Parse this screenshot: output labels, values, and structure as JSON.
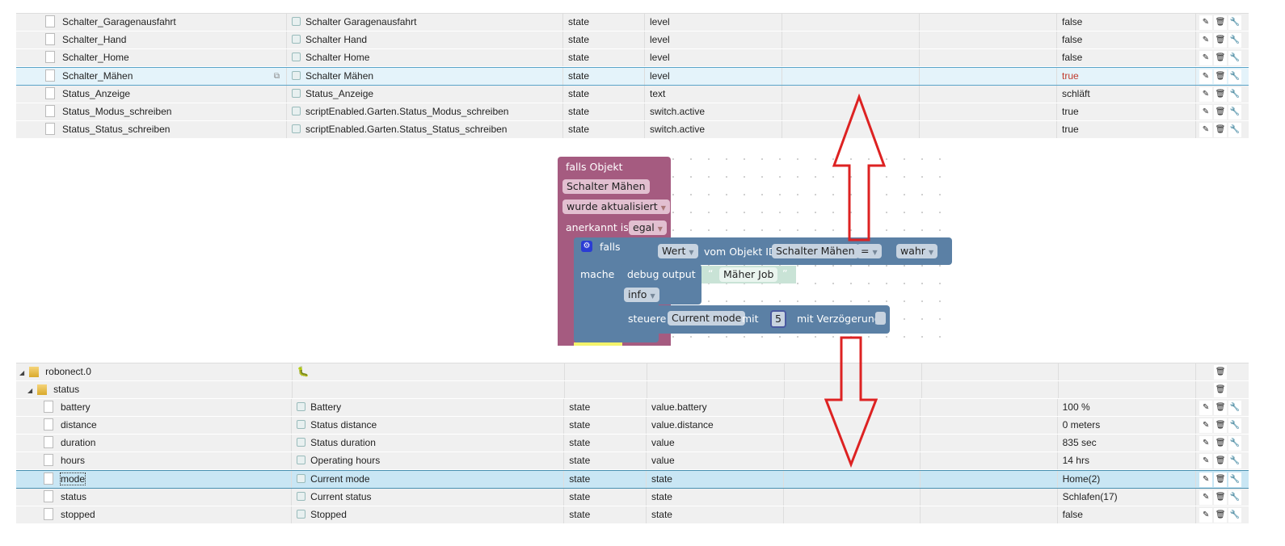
{
  "top_table": {
    "rows": [
      {
        "id": "Schalter_Garagenausfahrt",
        "name": "Schalter Garagenausfahrt",
        "type": "state",
        "role": "level",
        "value": "false"
      },
      {
        "id": "Schalter_Hand",
        "name": "Schalter Hand",
        "type": "state",
        "role": "level",
        "value": "false"
      },
      {
        "id": "Schalter_Home",
        "name": "Schalter Home",
        "type": "state",
        "role": "level",
        "value": "false"
      },
      {
        "id": "Schalter_Mähen",
        "name": "Schalter Mähen",
        "type": "state",
        "role": "level",
        "value": "true",
        "selected": true
      },
      {
        "id": "Status_Anzeige",
        "name": "Status_Anzeige",
        "type": "state",
        "role": "text",
        "value": "schläft"
      },
      {
        "id": "Status_Modus_schreiben",
        "name": "scriptEnabled.Garten.Status_Modus_schreiben",
        "type": "state",
        "role": "switch.active",
        "value": "true"
      },
      {
        "id": "Status_Status_schreiben",
        "name": "scriptEnabled.Garten.Status_Status_schreiben",
        "type": "state",
        "role": "switch.active",
        "value": "true"
      }
    ]
  },
  "blockly": {
    "trigger_label": "falls Objekt",
    "trigger_object": "Schalter Mähen",
    "trigger_event": "wurde aktualisiert",
    "ack_label": "anerkannt ist",
    "ack_value": "egal",
    "if_label": "falls",
    "do_label": "mache",
    "cond_prop": "Wert",
    "cond_of": "vom Objekt ID",
    "cond_object": "Schalter Mähen",
    "cond_op": "=",
    "cond_value": "wahr",
    "debug_label": "debug output",
    "debug_text": "Mäher Job",
    "debug_level": "info",
    "control_label": "steuere",
    "control_target": "Current mode",
    "control_with": "mit",
    "control_value": "5",
    "control_delay": "mit Verzögerung"
  },
  "bottom_table": {
    "adapter": "robonect.0",
    "channel": "status",
    "rows": [
      {
        "id": "battery",
        "name": "Battery",
        "type": "state",
        "role": "value.battery",
        "value": "100 %"
      },
      {
        "id": "distance",
        "name": "Status distance",
        "type": "state",
        "role": "value.distance",
        "value": "0 meters"
      },
      {
        "id": "duration",
        "name": "Status duration",
        "type": "state",
        "role": "value",
        "value": "835 sec"
      },
      {
        "id": "hours",
        "name": "Operating hours",
        "type": "state",
        "role": "value",
        "value": "14 hrs"
      },
      {
        "id": "mode",
        "name": "Current mode",
        "type": "state",
        "role": "state",
        "value": "Home(2)",
        "selected": true
      },
      {
        "id": "status",
        "name": "Current status",
        "type": "state",
        "role": "state",
        "value": "Schlafen(17)"
      },
      {
        "id": "stopped",
        "name": "Stopped",
        "type": "state",
        "role": "state",
        "value": "false"
      }
    ]
  },
  "colors": {
    "trigger_block": "#a55b80",
    "logic_block": "#5b80a5",
    "text_block": "#a5c8b8",
    "arrow": "#d22"
  }
}
